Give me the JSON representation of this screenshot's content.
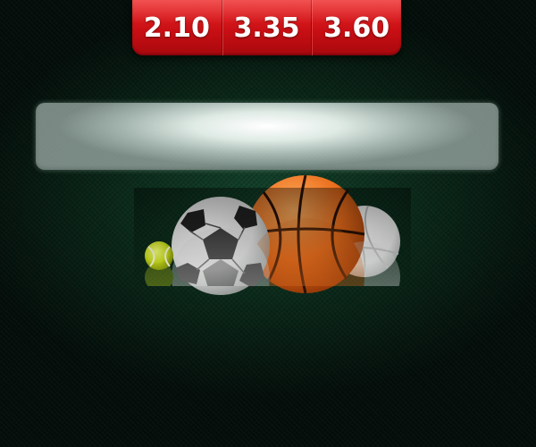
{
  "odds": {
    "home": "2.10",
    "draw": "3.35",
    "away": "3.60"
  },
  "colors": {
    "odds_red": "#d21a1f",
    "background_green": "#0f3a26"
  },
  "illustration": {
    "icons": [
      "tennis-ball-icon",
      "soccer-ball-icon",
      "basketball-icon",
      "volleyball-icon"
    ]
  }
}
